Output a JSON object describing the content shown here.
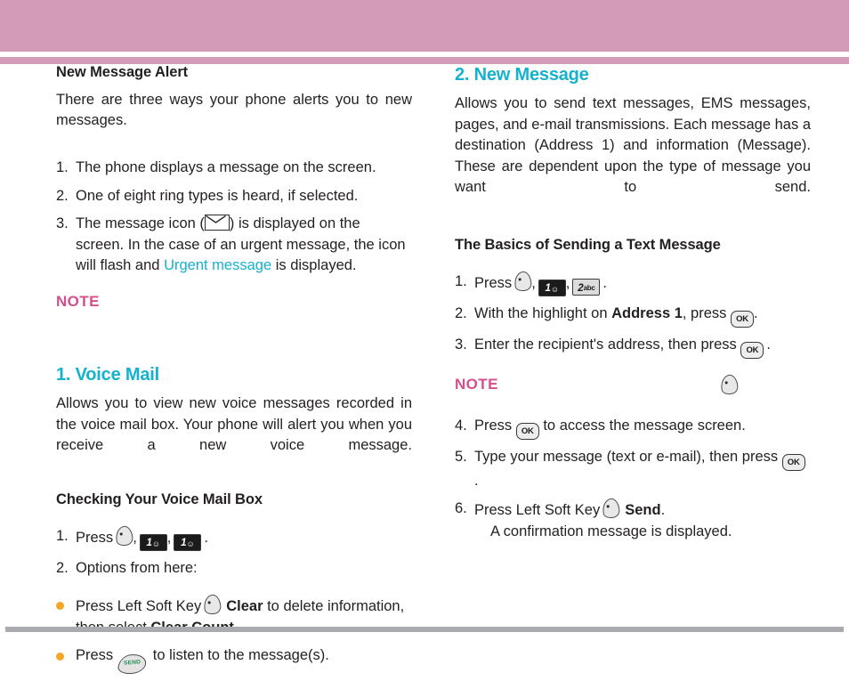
{
  "theme": {
    "header_band_color": "#d49bb8",
    "accent_cyan": "#14b2ce",
    "note_pink": "#d4508c",
    "bullet_orange": "#f5a623",
    "footer_rule_color": "#aaabaf",
    "text_color": "#231f20"
  },
  "icons": {
    "soft_key": "soft-key-icon",
    "key_1": "1",
    "key_1_sup": "voicemail",
    "key_2": "2",
    "key_2_sup": "abc",
    "ok_key": "OK",
    "send_key": "SEND",
    "envelope": "envelope-icon"
  },
  "left_column": {
    "alert": {
      "heading": "New Message Alert",
      "intro": "There are three ways your phone alerts you to new messages.",
      "steps": [
        {
          "num": "1.",
          "text": "The phone displays a message on the screen."
        },
        {
          "num": "2.",
          "text": "One of eight ring types is heard, if selected."
        }
      ],
      "step3": {
        "num": "3.",
        "part1": "The message icon (",
        "part2": ") is displayed on the screen. In the case of an urgent message, the icon will flash and ",
        "highlight": "Urgent message",
        "part3": " is displayed."
      },
      "note_label": "NOTE"
    },
    "voice_mail": {
      "heading": "1. Voice Mail",
      "intro": "Allows you to view new voice messages recorded in the voice mail box. Your phone will alert you when you receive a new voice message.",
      "subheading": "Checking Your Voice Mail Box",
      "step1": {
        "num": "1.",
        "prefix": "Press",
        "sep": ",",
        "suffix": "."
      },
      "step2": {
        "num": "2.",
        "text": "Options from here:"
      },
      "bullets": [
        {
          "prefix": "Press Left Soft Key",
          "bold1": "Clear",
          "mid": " to delete information, then select ",
          "bold2": "Clear Count",
          "suffix": "."
        },
        {
          "prefix": "Press",
          "suffix": " to listen to the message(s)."
        }
      ]
    }
  },
  "right_column": {
    "new_message": {
      "heading": "2. New Message",
      "intro": "Allows you to send text messages, EMS messages, pages, and e-mail transmissions. Each message has a destination (Address 1) and information (Message). These are dependent upon the type of message you want to send."
    },
    "basics": {
      "subheading": "The Basics of Sending a Text Message",
      "step1": {
        "num": "1.",
        "prefix": "Press",
        "sep": ",",
        "suffix": "."
      },
      "step2": {
        "num": "2.",
        "prefix": "With the highlight on ",
        "bold": "Address 1",
        "mid": ", press ",
        "suffix": "."
      },
      "step3": {
        "num": "3.",
        "prefix": "Enter the recipient's address, then press ",
        "suffix": "."
      },
      "note_label": "NOTE",
      "step4": {
        "num": "4.",
        "prefix": "Press ",
        "suffix": " to access the message screen."
      },
      "step5": {
        "num": "5.",
        "prefix": "Type your message (text or e-mail), then press ",
        "suffix": "."
      },
      "step6": {
        "num": "6.",
        "prefix": "Press Left Soft Key",
        "bold": "Send",
        "suffix": ".",
        "sub": "A confirmation message is displayed."
      }
    }
  }
}
